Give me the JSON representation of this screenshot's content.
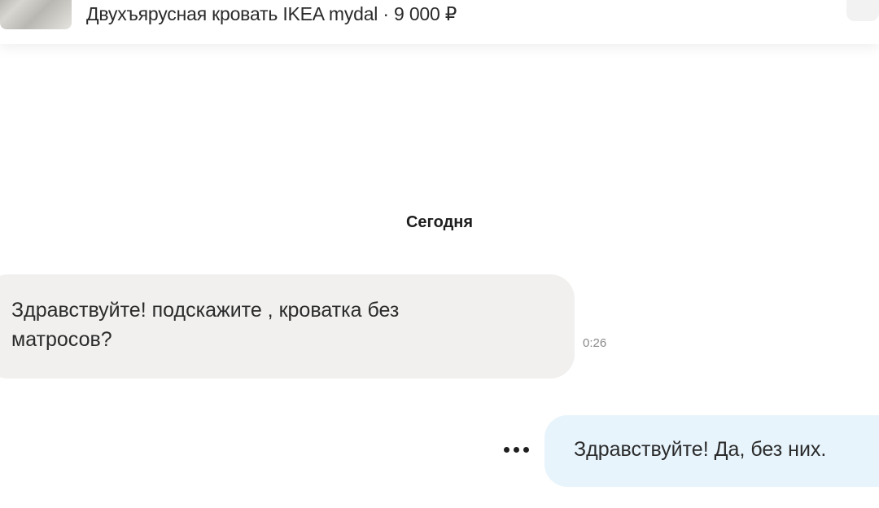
{
  "listing": {
    "title": "Двухъярусная кровать IKEA mydal · 9 000 ₽"
  },
  "chat": {
    "date_divider": "Сегодня",
    "messages": [
      {
        "direction": "incoming",
        "text": "Здравствуйте! подскажите , кроватка без матросов?",
        "time": "0:26"
      },
      {
        "direction": "outgoing",
        "text": "Здравствуйте! Да, без них."
      }
    ]
  },
  "icons": {
    "message_menu": "more-horizontal-icon"
  },
  "colors": {
    "incoming_bubble": "#f1f0ef",
    "outgoing_bubble": "#e7f4fc"
  }
}
